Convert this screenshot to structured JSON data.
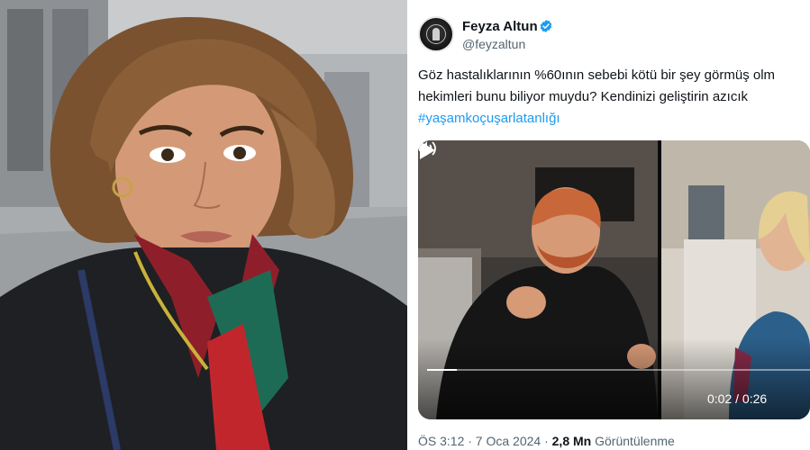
{
  "tweet": {
    "author_name": "Feyza Altun",
    "author_handle": "@feyzaltun",
    "text_line1": "Göz hastalıklarının %60ının sebebi kötü bir şey görmüş olm",
    "text_line2": "hekimleri bunu biliyor muydu? Kendinizi geliştirin azıcık",
    "hashtag": "#yaşamkoçuşarlatanlığı",
    "timestamp": "ÖS 3:12 · 7 Oca 2024 ·",
    "views_count": "2,8 Mn",
    "views_label": "Görüntülenme"
  },
  "video": {
    "time": "0:02 / 0:26",
    "progress": 0.077
  },
  "icons": {
    "verified": "verified-badge-icon",
    "play": "play-icon",
    "volume": "volume-icon"
  },
  "colors": {
    "link": "#1d9bf0",
    "verified": "#1d9bf0",
    "text": "#0f1419",
    "secondary": "#536471"
  }
}
